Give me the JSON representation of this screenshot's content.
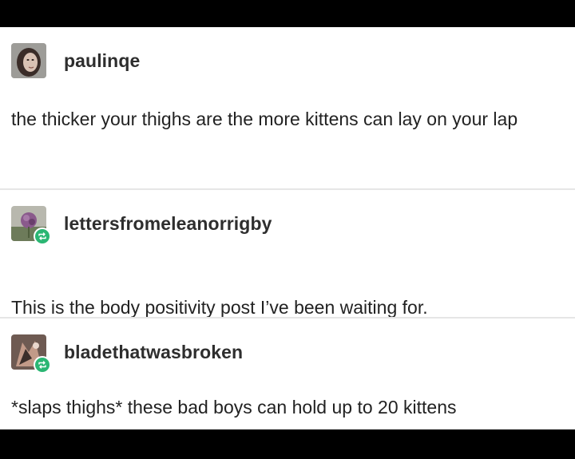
{
  "posts": [
    {
      "username": "paulinqe",
      "avatar_icon": "profile-photo-icon",
      "reblog": false,
      "text": "the thicker your thighs are the more kittens can lay on your lap"
    },
    {
      "username": "lettersfromeleanorrigby",
      "avatar_icon": "flower-photo-icon",
      "reblog": true,
      "text": "This is the body positivity post I’ve been waiting for."
    },
    {
      "username": "bladethatwasbroken",
      "avatar_icon": "artwork-photo-icon",
      "reblog": true,
      "text": "*slaps thighs* these bad boys can hold up to 20 kittens"
    }
  ],
  "colors": {
    "background": "#000000",
    "card": "#ffffff",
    "text": "#222222",
    "reblog_badge": "#2bb673",
    "divider": "#e6e6e6"
  }
}
